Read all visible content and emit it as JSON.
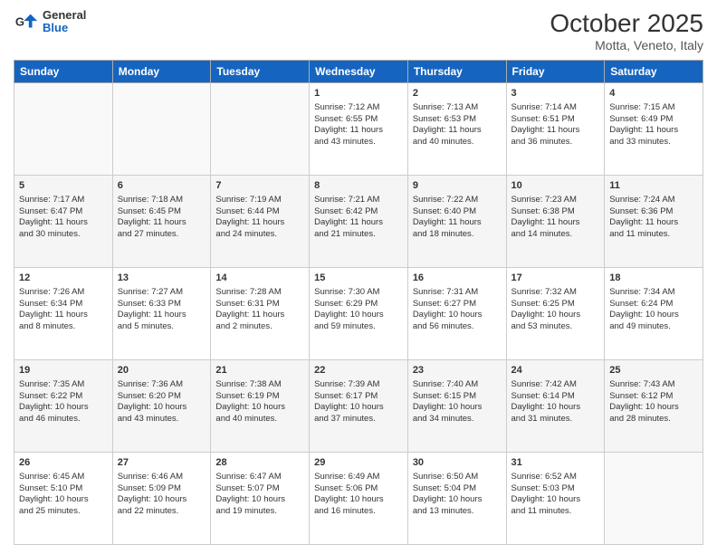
{
  "header": {
    "logo_general": "General",
    "logo_blue": "Blue",
    "title": "October 2025",
    "location": "Motta, Veneto, Italy"
  },
  "weekdays": [
    "Sunday",
    "Monday",
    "Tuesday",
    "Wednesday",
    "Thursday",
    "Friday",
    "Saturday"
  ],
  "weeks": [
    [
      {
        "day": "",
        "info": ""
      },
      {
        "day": "",
        "info": ""
      },
      {
        "day": "",
        "info": ""
      },
      {
        "day": "1",
        "info": "Sunrise: 7:12 AM\nSunset: 6:55 PM\nDaylight: 11 hours\nand 43 minutes."
      },
      {
        "day": "2",
        "info": "Sunrise: 7:13 AM\nSunset: 6:53 PM\nDaylight: 11 hours\nand 40 minutes."
      },
      {
        "day": "3",
        "info": "Sunrise: 7:14 AM\nSunset: 6:51 PM\nDaylight: 11 hours\nand 36 minutes."
      },
      {
        "day": "4",
        "info": "Sunrise: 7:15 AM\nSunset: 6:49 PM\nDaylight: 11 hours\nand 33 minutes."
      }
    ],
    [
      {
        "day": "5",
        "info": "Sunrise: 7:17 AM\nSunset: 6:47 PM\nDaylight: 11 hours\nand 30 minutes."
      },
      {
        "day": "6",
        "info": "Sunrise: 7:18 AM\nSunset: 6:45 PM\nDaylight: 11 hours\nand 27 minutes."
      },
      {
        "day": "7",
        "info": "Sunrise: 7:19 AM\nSunset: 6:44 PM\nDaylight: 11 hours\nand 24 minutes."
      },
      {
        "day": "8",
        "info": "Sunrise: 7:21 AM\nSunset: 6:42 PM\nDaylight: 11 hours\nand 21 minutes."
      },
      {
        "day": "9",
        "info": "Sunrise: 7:22 AM\nSunset: 6:40 PM\nDaylight: 11 hours\nand 18 minutes."
      },
      {
        "day": "10",
        "info": "Sunrise: 7:23 AM\nSunset: 6:38 PM\nDaylight: 11 hours\nand 14 minutes."
      },
      {
        "day": "11",
        "info": "Sunrise: 7:24 AM\nSunset: 6:36 PM\nDaylight: 11 hours\nand 11 minutes."
      }
    ],
    [
      {
        "day": "12",
        "info": "Sunrise: 7:26 AM\nSunset: 6:34 PM\nDaylight: 11 hours\nand 8 minutes."
      },
      {
        "day": "13",
        "info": "Sunrise: 7:27 AM\nSunset: 6:33 PM\nDaylight: 11 hours\nand 5 minutes."
      },
      {
        "day": "14",
        "info": "Sunrise: 7:28 AM\nSunset: 6:31 PM\nDaylight: 11 hours\nand 2 minutes."
      },
      {
        "day": "15",
        "info": "Sunrise: 7:30 AM\nSunset: 6:29 PM\nDaylight: 10 hours\nand 59 minutes."
      },
      {
        "day": "16",
        "info": "Sunrise: 7:31 AM\nSunset: 6:27 PM\nDaylight: 10 hours\nand 56 minutes."
      },
      {
        "day": "17",
        "info": "Sunrise: 7:32 AM\nSunset: 6:25 PM\nDaylight: 10 hours\nand 53 minutes."
      },
      {
        "day": "18",
        "info": "Sunrise: 7:34 AM\nSunset: 6:24 PM\nDaylight: 10 hours\nand 49 minutes."
      }
    ],
    [
      {
        "day": "19",
        "info": "Sunrise: 7:35 AM\nSunset: 6:22 PM\nDaylight: 10 hours\nand 46 minutes."
      },
      {
        "day": "20",
        "info": "Sunrise: 7:36 AM\nSunset: 6:20 PM\nDaylight: 10 hours\nand 43 minutes."
      },
      {
        "day": "21",
        "info": "Sunrise: 7:38 AM\nSunset: 6:19 PM\nDaylight: 10 hours\nand 40 minutes."
      },
      {
        "day": "22",
        "info": "Sunrise: 7:39 AM\nSunset: 6:17 PM\nDaylight: 10 hours\nand 37 minutes."
      },
      {
        "day": "23",
        "info": "Sunrise: 7:40 AM\nSunset: 6:15 PM\nDaylight: 10 hours\nand 34 minutes."
      },
      {
        "day": "24",
        "info": "Sunrise: 7:42 AM\nSunset: 6:14 PM\nDaylight: 10 hours\nand 31 minutes."
      },
      {
        "day": "25",
        "info": "Sunrise: 7:43 AM\nSunset: 6:12 PM\nDaylight: 10 hours\nand 28 minutes."
      }
    ],
    [
      {
        "day": "26",
        "info": "Sunrise: 6:45 AM\nSunset: 5:10 PM\nDaylight: 10 hours\nand 25 minutes."
      },
      {
        "day": "27",
        "info": "Sunrise: 6:46 AM\nSunset: 5:09 PM\nDaylight: 10 hours\nand 22 minutes."
      },
      {
        "day": "28",
        "info": "Sunrise: 6:47 AM\nSunset: 5:07 PM\nDaylight: 10 hours\nand 19 minutes."
      },
      {
        "day": "29",
        "info": "Sunrise: 6:49 AM\nSunset: 5:06 PM\nDaylight: 10 hours\nand 16 minutes."
      },
      {
        "day": "30",
        "info": "Sunrise: 6:50 AM\nSunset: 5:04 PM\nDaylight: 10 hours\nand 13 minutes."
      },
      {
        "day": "31",
        "info": "Sunrise: 6:52 AM\nSunset: 5:03 PM\nDaylight: 10 hours\nand 11 minutes."
      },
      {
        "day": "",
        "info": ""
      }
    ]
  ]
}
